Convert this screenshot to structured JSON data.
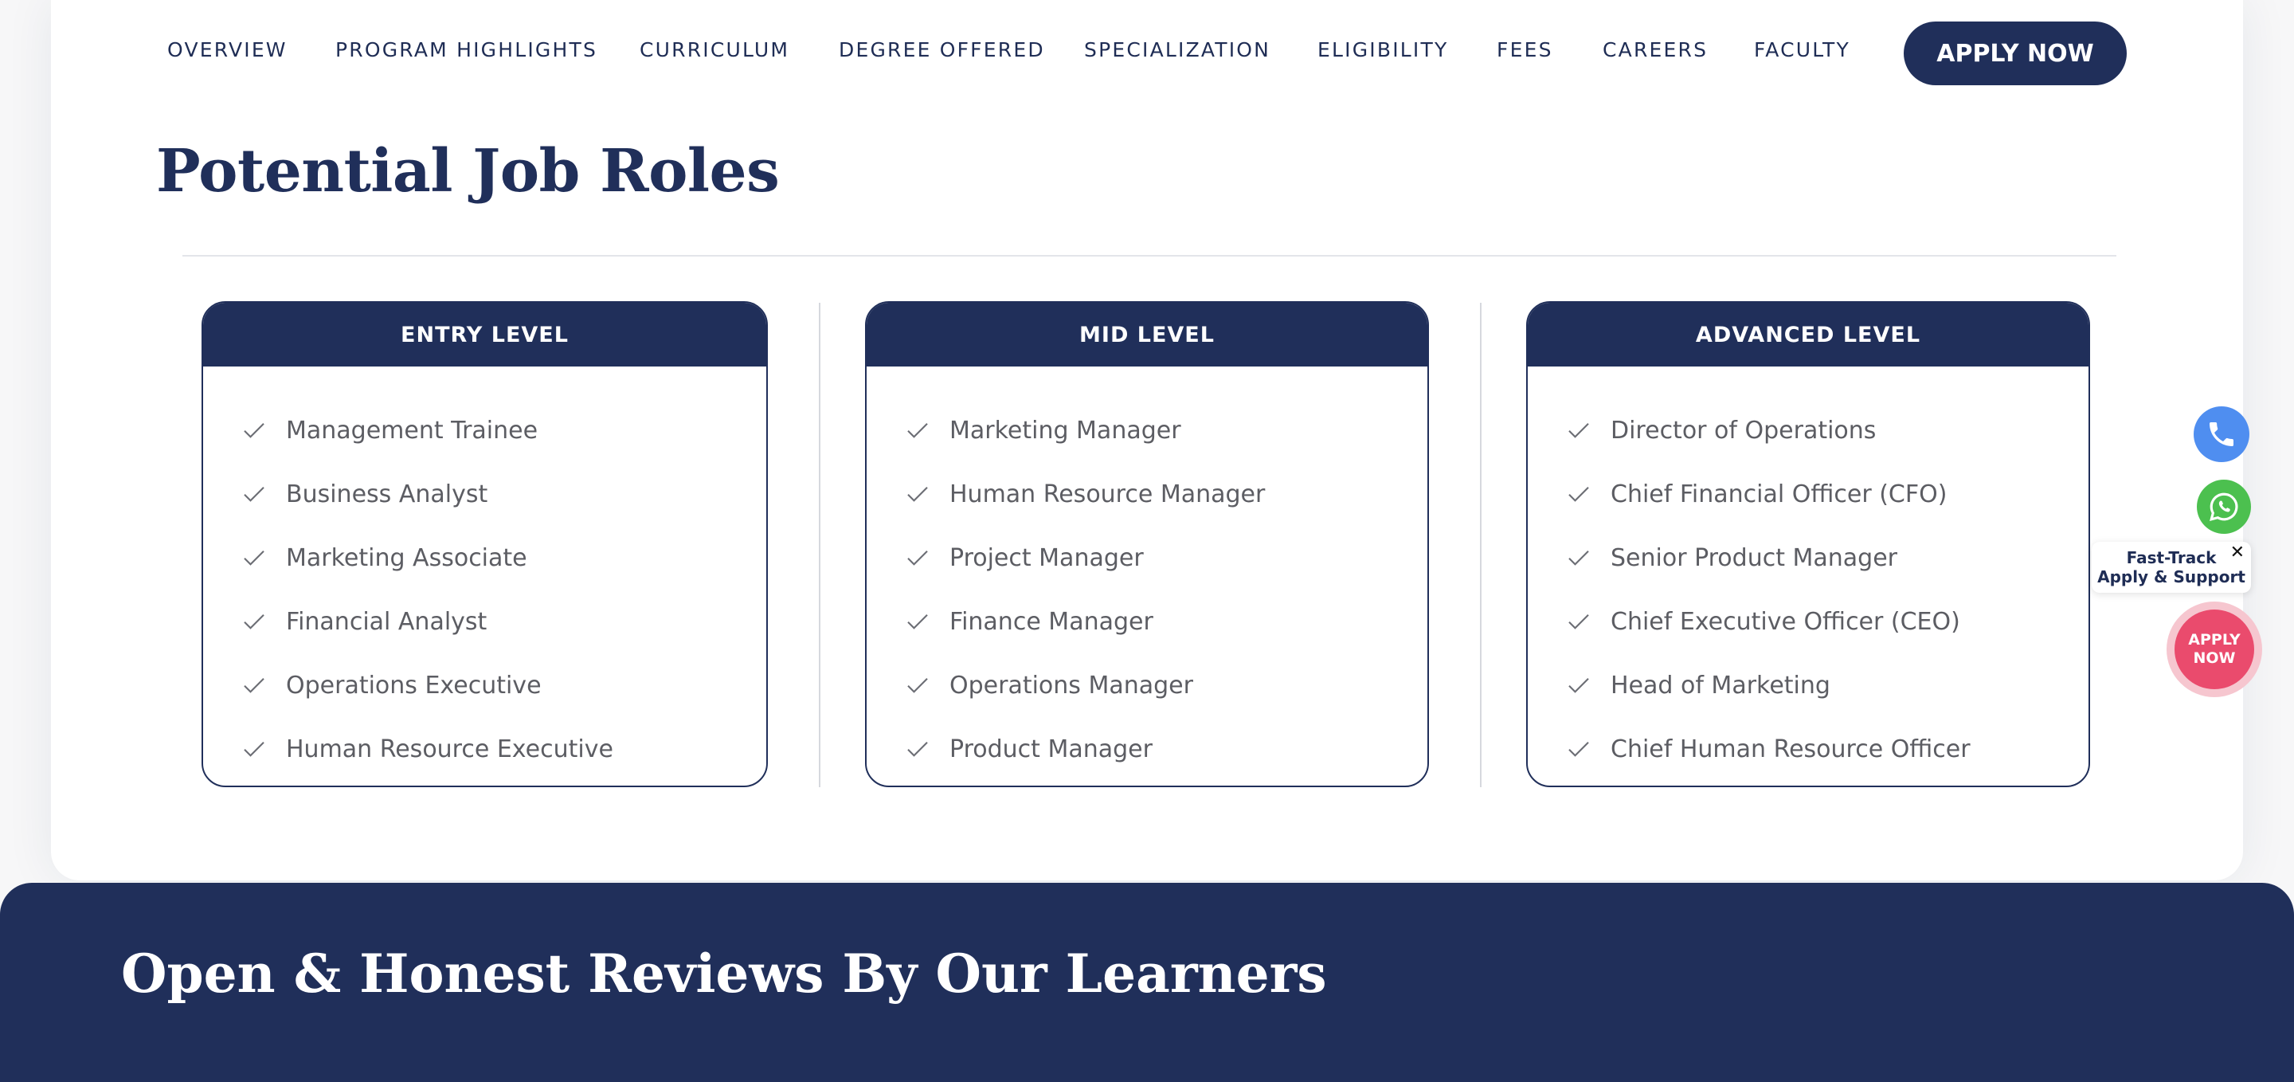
{
  "nav": {
    "items": [
      "OVERVIEW",
      "PROGRAM HIGHLIGHTS",
      "CURRICULUM",
      "DEGREE OFFERED",
      "SPECIALIZATION",
      "ELIGIBILITY",
      "FEES",
      "CAREERS",
      "FACULTY"
    ],
    "apply_label": "APPLY NOW"
  },
  "section_title": "Potential Job Roles",
  "levels": [
    {
      "title": "ENTRY LEVEL",
      "roles": [
        "Management Trainee",
        "Business Analyst",
        "Marketing Associate",
        "Financial Analyst",
        "Operations Executive",
        "Human Resource Executive"
      ]
    },
    {
      "title": "MID LEVEL",
      "roles": [
        "Marketing Manager",
        "Human Resource Manager",
        "Project Manager",
        "Finance Manager",
        "Operations Manager",
        "Product Manager"
      ]
    },
    {
      "title": "ADVANCED LEVEL",
      "roles": [
        "Director of Operations",
        "Chief Financial Officer (CFO)",
        "Senior Product Manager",
        "Chief Executive Officer (CEO)",
        "Head of Marketing",
        "Chief Human Resource Officer"
      ]
    }
  ],
  "reviews_title": "Open & Honest Reviews By Our Learners",
  "widgets": {
    "fast_track_line1": "Fast-Track",
    "fast_track_line2": "Apply & Support",
    "close_glyph": "✕",
    "apply_line1": "APPLY",
    "apply_line2": "NOW"
  },
  "colors": {
    "navy": "#202f5a",
    "text_gray": "#5c5d63",
    "phone_blue": "#4f8ef0",
    "whatsapp_green": "#4cc04f",
    "apply_pink": "#ea4b6d"
  }
}
